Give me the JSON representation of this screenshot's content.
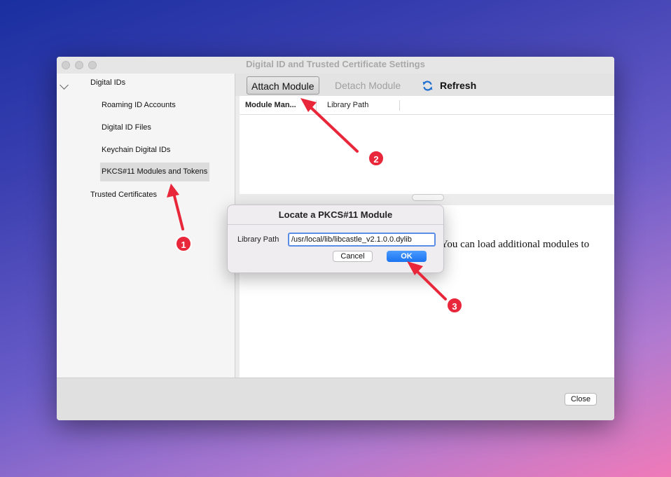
{
  "window": {
    "title": "Digital ID and Trusted Certificate Settings"
  },
  "sidebar": {
    "items": [
      {
        "label": "Digital IDs"
      },
      {
        "label": "Roaming ID Accounts"
      },
      {
        "label": "Digital ID Files"
      },
      {
        "label": "Keychain Digital IDs"
      },
      {
        "label": "PKCS#11 Modules and Tokens"
      },
      {
        "label": "Trusted Certificates"
      }
    ]
  },
  "toolbar": {
    "attach_label": "Attach Module",
    "detach_label": "Detach Module",
    "refresh_label": "Refresh"
  },
  "table": {
    "columns": [
      "Module Man...",
      "Library Path"
    ]
  },
  "info": {
    "text": "You can load additional modules to"
  },
  "footer": {
    "close_label": "Close"
  },
  "dialog": {
    "title": "Locate a PKCS#11 Module",
    "label": "Library Path",
    "value": "/usr/local/lib/libcastle_v2.1.0.0.dylib",
    "cancel_label": "Cancel",
    "ok_label": "OK"
  },
  "annotations": [
    {
      "number": "1"
    },
    {
      "number": "2"
    },
    {
      "number": "3"
    }
  ],
  "colors": {
    "accent": "#1a74f0",
    "annotation": "#e8283a"
  }
}
